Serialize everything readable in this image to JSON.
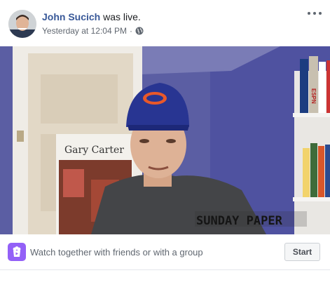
{
  "post": {
    "author_name": "John Sucich",
    "action_text": "was live.",
    "timestamp": "Yesterday at 12:04 PM",
    "separator": "·",
    "privacy_icon": "globe-icon"
  },
  "menu": {
    "icon": "more-options-icon"
  },
  "video": {
    "poster_text": "Gary Carter",
    "shirt_text": "SUNDAY PAPER",
    "book_spine_text": "ESPN"
  },
  "watch_party": {
    "icon": "watch-party-icon",
    "label": "Watch together with friends or with a group",
    "button_label": "Start"
  },
  "colors": {
    "link": "#385898",
    "wall": "#5a5ca0",
    "watch_icon_bg": "#9360f7"
  }
}
